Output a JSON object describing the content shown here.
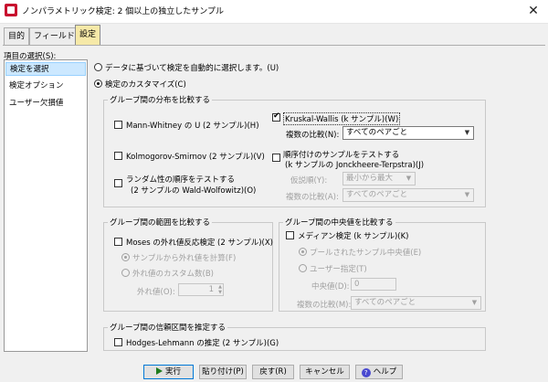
{
  "window": {
    "title": "ノンパラメトリック検定: 2 個以上の独立したサンプル",
    "close": "✕"
  },
  "tabs": [
    {
      "label": "目的"
    },
    {
      "label": "フィールド"
    },
    {
      "label": "設定"
    }
  ],
  "left": {
    "label": "項目の選択(S):",
    "items": [
      {
        "label": "検定を選択"
      },
      {
        "label": "検定オプション"
      },
      {
        "label": "ユーザー欠損値"
      }
    ]
  },
  "main": {
    "auto_radio": "データに基づいて検定を自動的に選択します。(U)",
    "custom_radio": "検定のカスタマイズ(C)",
    "dist_group": {
      "title": "グループ間の分布を比較する",
      "mann_whitney": "Mann-Whitney の U (2 サンプル)(H)",
      "kolmogorov": "Kolmogorov-Smirnov (2 サンプル)(V)",
      "runs_line1": "ランダム性の順序をテストする",
      "runs_line2": "(2 サンプルの Wald-Wolfowitz)(O)",
      "kruskal": "Kruskal-Wallis (k サンプル)(W)",
      "multi_compare_label": "複数の比較(N):",
      "multi_compare_value": "すべてのペアごと",
      "ordered_line1": "順序付けのサンプルをテストする",
      "ordered_line2": "(k サンプルの Jonckheere-Terpstra)(J)",
      "hypothesis_label": "仮説順(Y):",
      "hypothesis_value": "最小から最大",
      "multi_compare2_label": "複数の比較(A):",
      "multi_compare2_value": "すべてのペアごと"
    },
    "range_group": {
      "title": "グループ間の範囲を比較する",
      "moses": "Moses の外れ値反応検定 (2 サンプル)(X)",
      "compute_outliers": "サンプルから外れ値を計算(F)",
      "custom_outliers": "外れ値のカスタム数(B)",
      "outliers_label": "外れ値(O):",
      "outliers_value": "1"
    },
    "median_group": {
      "title": "グループ間の中央値を比較する",
      "median_test": "メディアン検定 (k サンプル)(K)",
      "pooled": "プールされたサンプル中央値(E)",
      "user_specified": "ユーザー指定(T)",
      "median_label": "中央値(D):",
      "median_value": "0",
      "multi_compare_label": "複数の比較(M):",
      "multi_compare_value": "すべてのペアごと"
    },
    "ci_group": {
      "title": "グループ間の信頼区間を推定する",
      "hodges": "Hodges-Lehmann の推定 (2 サンプル)(G)"
    }
  },
  "buttons": {
    "run": "実行",
    "paste": "貼り付け(P)",
    "reset": "戻す(R)",
    "cancel": "キャンセル",
    "help": "ヘルプ"
  },
  "colors": {
    "active_tab": "#f6e9a8",
    "selection": "#cce8ff",
    "app_icon": "#c8102e"
  }
}
